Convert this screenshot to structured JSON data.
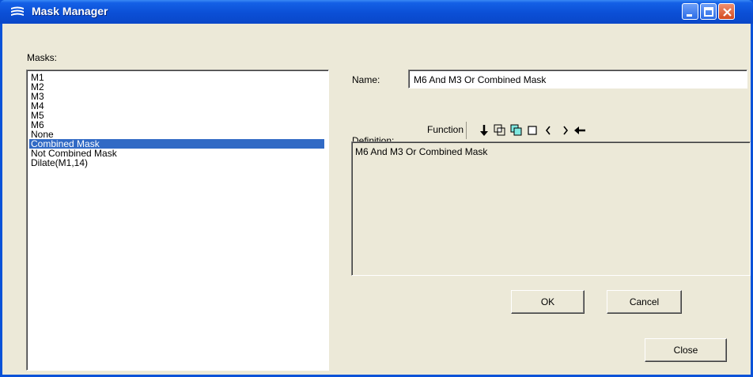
{
  "window": {
    "title": "Mask Manager"
  },
  "masks": {
    "label": "Masks:",
    "items": [
      "M1",
      "M2",
      "M3",
      "M4",
      "M5",
      "M6",
      "None",
      "Combined Mask",
      "Not Combined Mask",
      "Dilate(M1,14)"
    ],
    "selected_index": 7
  },
  "name": {
    "label": "Name:",
    "value": "M6 And M3 Or Combined Mask"
  },
  "definition": {
    "label": "Definition:",
    "function_label": "Function",
    "text": "M6 And M3 Or Combined Mask",
    "tools": [
      "down-arrow-icon",
      "intersect-icon",
      "union-icon",
      "square-icon",
      "left-paren-icon",
      "right-paren-icon",
      "backspace-arrow-icon"
    ]
  },
  "buttons": {
    "ok": "OK",
    "cancel": "Cancel",
    "close": "Close"
  },
  "colors": {
    "title_bar": "#0a52d8",
    "selection": "#316ac5",
    "dialog_bg": "#ece9d8"
  }
}
